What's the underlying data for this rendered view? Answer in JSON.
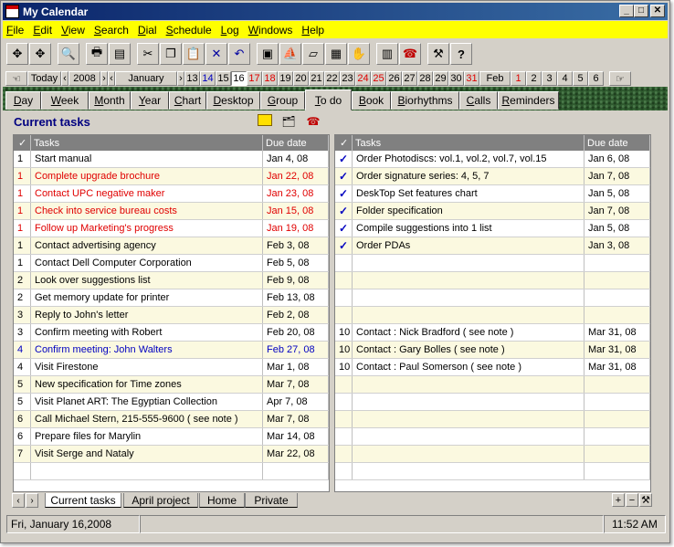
{
  "window": {
    "title": "My Calendar"
  },
  "menu": [
    "File",
    "Edit",
    "View",
    "Search",
    "Dial",
    "Schedule",
    "Log",
    "Windows",
    "Help"
  ],
  "toolbar_icons": [
    "move-icon",
    "move-all-icon",
    "find-icon",
    "print-icon",
    "print-setup-icon",
    "cut-icon",
    "copy-icon",
    "paste-icon",
    "delete-icon",
    "undo-icon",
    "photo-icon",
    "ship-icon",
    "postit-icon",
    "memo-icon",
    "hand-icon",
    "notebook-icon",
    "phone-icon",
    "tools-icon",
    "help-icon"
  ],
  "datebar": {
    "today": "Today",
    "year": "2008",
    "month": "January",
    "days": [
      {
        "d": "13",
        "c": "n"
      },
      {
        "d": "14",
        "c": "b"
      },
      {
        "d": "15",
        "c": "n"
      },
      {
        "d": "16",
        "c": "t"
      },
      {
        "d": "17",
        "c": "r"
      },
      {
        "d": "18",
        "c": "r"
      },
      {
        "d": "19",
        "c": "n"
      },
      {
        "d": "20",
        "c": "n"
      },
      {
        "d": "21",
        "c": "n"
      },
      {
        "d": "22",
        "c": "n"
      },
      {
        "d": "23",
        "c": "n"
      },
      {
        "d": "24",
        "c": "r"
      },
      {
        "d": "25",
        "c": "r"
      },
      {
        "d": "26",
        "c": "n"
      },
      {
        "d": "27",
        "c": "n"
      },
      {
        "d": "28",
        "c": "n"
      },
      {
        "d": "29",
        "c": "n"
      },
      {
        "d": "30",
        "c": "n"
      },
      {
        "d": "31",
        "c": "r"
      }
    ],
    "next_month": "Feb",
    "next_days": [
      {
        "d": "1",
        "c": "r"
      },
      {
        "d": "2",
        "c": "n"
      },
      {
        "d": "3",
        "c": "n"
      },
      {
        "d": "4",
        "c": "n"
      },
      {
        "d": "5",
        "c": "n"
      },
      {
        "d": "6",
        "c": "n"
      }
    ]
  },
  "view_tabs": [
    "Day",
    "Week",
    "Month",
    "Year",
    "Chart",
    "Desktop",
    "Group",
    "To do",
    "Book",
    "Biorhythms",
    "Calls",
    "Reminders"
  ],
  "active_view_tab": "To do",
  "heading": "Current tasks",
  "left_table": {
    "headers": [
      "✓",
      "Tasks",
      "Due date"
    ],
    "rows": [
      {
        "p": "1",
        "t": "Start manual",
        "d": "Jan 4, 08",
        "s": ""
      },
      {
        "p": "1",
        "t": "Complete upgrade brochure",
        "d": "Jan 22, 08",
        "s": "red"
      },
      {
        "p": "1",
        "t": "Contact UPC negative maker",
        "d": "Jan 23, 08",
        "s": "red"
      },
      {
        "p": "1",
        "t": "Check into service bureau costs",
        "d": "Jan 15, 08",
        "s": "red"
      },
      {
        "p": "1",
        "t": "Follow up Marketing's progress",
        "d": "Jan 19, 08",
        "s": "red"
      },
      {
        "p": "1",
        "t": "Contact advertising agency",
        "d": "Feb 3, 08",
        "s": ""
      },
      {
        "p": "1",
        "t": "Contact Dell Computer Corporation",
        "d": "Feb 5, 08",
        "s": ""
      },
      {
        "p": "2",
        "t": "Look over suggestions list",
        "d": "Feb 9, 08",
        "s": ""
      },
      {
        "p": "2",
        "t": "Get memory  update for printer",
        "d": "Feb 13, 08",
        "s": ""
      },
      {
        "p": "3",
        "t": "Reply to John's letter",
        "d": "Feb 2, 08",
        "s": ""
      },
      {
        "p": "3",
        "t": "Confirm meeting with Robert",
        "d": "Feb 20, 08",
        "s": ""
      },
      {
        "p": "4",
        "t": "Confirm meeting: John Walters",
        "d": "Feb 27, 08",
        "s": "blue"
      },
      {
        "p": "4",
        "t": "Visit Firestone",
        "d": "Mar 1, 08",
        "s": ""
      },
      {
        "p": "5",
        "t": "New specification for Time zones",
        "d": "Mar 7, 08",
        "s": ""
      },
      {
        "p": "5",
        "t": "Visit Planet ART: The Egyptian Collection",
        "d": "Apr 7, 08",
        "s": ""
      },
      {
        "p": "6",
        "t": "Call Michael Stern, 215-555-9600     ( see note )",
        "d": "Mar 7, 08",
        "s": ""
      },
      {
        "p": "6",
        "t": "Prepare files for Marylin",
        "d": "Mar 14, 08",
        "s": ""
      },
      {
        "p": "7",
        "t": "Visit Serge and Nataly",
        "d": "Mar 22, 08",
        "s": ""
      },
      {
        "p": "",
        "t": "",
        "d": "",
        "s": ""
      }
    ]
  },
  "right_table": {
    "headers": [
      "✓",
      "Tasks",
      "Due date"
    ],
    "rows": [
      {
        "p": "✓",
        "t": "Order Photodiscs: vol.1, vol.2, vol.7, vol.15",
        "d": "Jan 6, 08",
        "s": "chk"
      },
      {
        "p": "✓",
        "t": "Order signature series: 4, 5, 7",
        "d": "Jan 7, 08",
        "s": "chk"
      },
      {
        "p": "✓",
        "t": "DeskTop Set features chart",
        "d": "Jan 5, 08",
        "s": "chk"
      },
      {
        "p": "✓",
        "t": "Folder specification",
        "d": "Jan 7, 08",
        "s": "chk"
      },
      {
        "p": "✓",
        "t": "Compile suggestions into 1 list",
        "d": "Jan 5, 08",
        "s": "chk"
      },
      {
        "p": "✓",
        "t": "Order PDAs",
        "d": "Jan 3, 08",
        "s": "chk"
      },
      {
        "p": "",
        "t": "",
        "d": "",
        "s": ""
      },
      {
        "p": "",
        "t": "",
        "d": "",
        "s": ""
      },
      {
        "p": "",
        "t": "",
        "d": "",
        "s": ""
      },
      {
        "p": "",
        "t": "",
        "d": "",
        "s": ""
      },
      {
        "p": "10",
        "t": "Contact : Nick Bradford         ( see note )",
        "d": "Mar 31, 08",
        "s": ""
      },
      {
        "p": "10",
        "t": "Contact : Gary Bolles            ( see note )",
        "d": "Mar 31, 08",
        "s": ""
      },
      {
        "p": "10",
        "t": "Contact : Paul Somerson        ( see note )",
        "d": "Mar 31, 08",
        "s": ""
      },
      {
        "p": "",
        "t": "",
        "d": "",
        "s": ""
      },
      {
        "p": "",
        "t": "",
        "d": "",
        "s": ""
      },
      {
        "p": "",
        "t": "",
        "d": "",
        "s": ""
      },
      {
        "p": "",
        "t": "",
        "d": "",
        "s": ""
      },
      {
        "p": "",
        "t": "",
        "d": "",
        "s": ""
      },
      {
        "p": "",
        "t": "",
        "d": "",
        "s": ""
      }
    ]
  },
  "bottom_tabs": [
    "Current tasks",
    "April project",
    "Home",
    "Private"
  ],
  "active_bottom_tab": "Current tasks",
  "status": {
    "date": "Fri, January 16,2008",
    "time": "11:52 AM"
  }
}
